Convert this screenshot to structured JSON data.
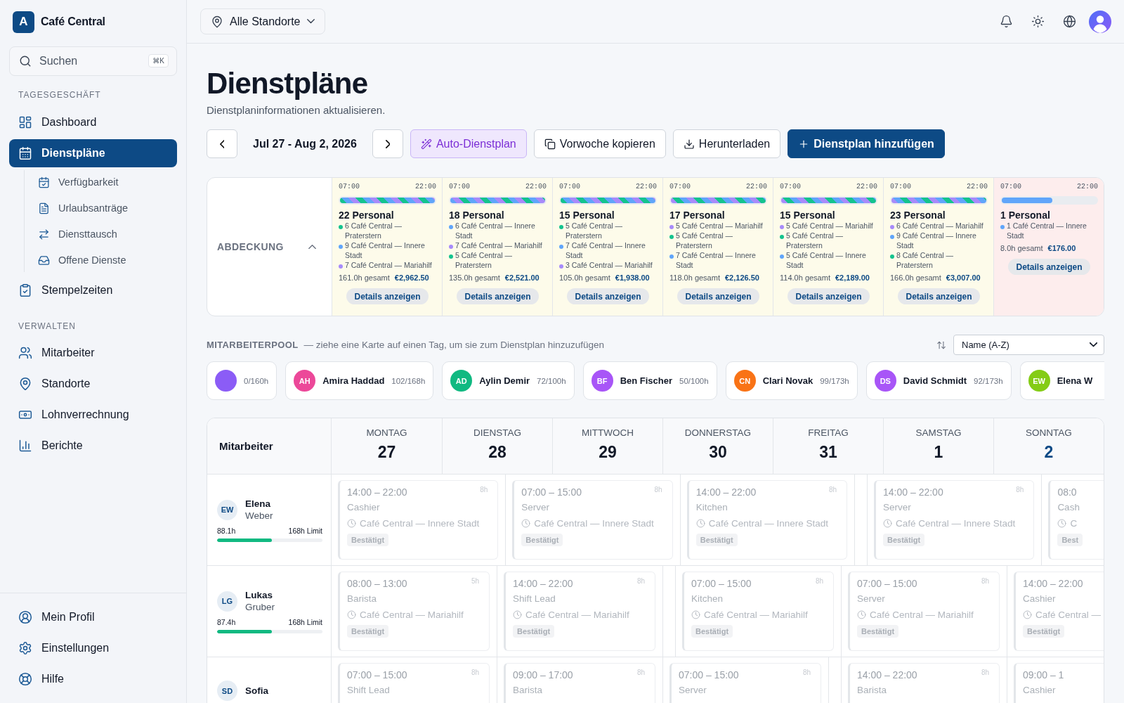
{
  "app": {
    "logo": "A",
    "name": "Café Central"
  },
  "search": {
    "placeholder": "Suchen",
    "shortcut": "⌘K"
  },
  "sidebar": {
    "sections": [
      {
        "title": "TAGESGESCHÄFT",
        "items": [
          {
            "label": "Dashboard",
            "selected": false
          },
          {
            "label": "Dienstpläne",
            "selected": true,
            "children": [
              {
                "label": "Verfügbarkeit",
                "selected": false
              },
              {
                "label": "Urlaubsanträge",
                "selected": false
              },
              {
                "label": "Diensttausch",
                "selected": false
              },
              {
                "label": "Offene Dienste",
                "selected": false
              }
            ]
          },
          {
            "label": "Stempelzeiten",
            "selected": false
          }
        ]
      },
      {
        "title": "VERWALTEN",
        "items": [
          {
            "label": "Mitarbeiter",
            "selected": false
          },
          {
            "label": "Standorte",
            "selected": false
          },
          {
            "label": "Lohnverrechnung",
            "selected": false
          },
          {
            "label": "Berichte",
            "selected": false
          }
        ]
      }
    ],
    "footer": [
      {
        "label": "Mein Profil",
        "selected": false
      },
      {
        "label": "Einstellungen",
        "selected": false
      },
      {
        "label": "Hilfe",
        "selected": false
      }
    ]
  },
  "topbar": {
    "location": "Alle Standorte"
  },
  "page": {
    "title": "Dienstpläne",
    "subtitle": "Dienstplaninformationen aktualisieren."
  },
  "toolbar": {
    "range": "Jul 27 - Aug 2, 2026",
    "buttons": [
      {
        "label": "Auto-Dienstplan",
        "kind": "magic"
      },
      {
        "label": "Vorwoche kopieren",
        "kind": "copy"
      },
      {
        "label": "Herunterladen",
        "kind": "download"
      },
      {
        "label": "Dienstplan hinzufügen",
        "kind": "add"
      }
    ]
  },
  "coverage": {
    "label": "ABDECKUNG",
    "expanded": true,
    "days": [
      {
        "start": "07:00",
        "end": "22:00",
        "level": 1,
        "staff": "22 Personal",
        "locations": [
          {
            "text": "6 Café Central — Praterstern",
            "color": "#14c38e"
          },
          {
            "text": "9 Café Central — Innere Stadt",
            "color": "#60a5fa"
          },
          {
            "text": "7 Café Central — Mariahilf",
            "color": "#a78bfa"
          }
        ],
        "hours": "161.0h gesamt",
        "cost": "€2,962.50",
        "button": "Details anzeigen",
        "understaffed": false
      },
      {
        "start": "07:00",
        "end": "22:00",
        "level": 1,
        "staff": "18 Personal",
        "locations": [
          {
            "text": "6 Café Central — Innere Stadt",
            "color": "#60a5fa"
          },
          {
            "text": "7 Café Central — Mariahilf",
            "color": "#a78bfa"
          },
          {
            "text": "5 Café Central — Praterstern",
            "color": "#14c38e"
          }
        ],
        "hours": "135.0h gesamt",
        "cost": "€2,521.00",
        "button": "Details anzeigen",
        "understaffed": false
      },
      {
        "start": "07:00",
        "end": "22:00",
        "level": 1,
        "staff": "15 Personal",
        "locations": [
          {
            "text": "5 Café Central — Praterstern",
            "color": "#14c38e"
          },
          {
            "text": "7 Café Central — Innere Stadt",
            "color": "#60a5fa"
          },
          {
            "text": "3 Café Central — Mariahilf",
            "color": "#a78bfa"
          }
        ],
        "hours": "105.0h gesamt",
        "cost": "€1,938.00",
        "button": "Details anzeigen",
        "understaffed": false
      },
      {
        "start": "07:00",
        "end": "22:00",
        "level": 1,
        "staff": "17 Personal",
        "locations": [
          {
            "text": "5 Café Central — Mariahilf",
            "color": "#a78bfa"
          },
          {
            "text": "5 Café Central — Praterstern",
            "color": "#14c38e"
          },
          {
            "text": "7 Café Central — Innere Stadt",
            "color": "#60a5fa"
          }
        ],
        "hours": "118.0h gesamt",
        "cost": "€2,126.50",
        "button": "Details anzeigen",
        "understaffed": false
      },
      {
        "start": "07:00",
        "end": "22:00",
        "level": 1,
        "staff": "15 Personal",
        "locations": [
          {
            "text": "5 Café Central — Mariahilf",
            "color": "#a78bfa"
          },
          {
            "text": "5 Café Central — Praterstern",
            "color": "#14c38e"
          },
          {
            "text": "5 Café Central — Innere Stadt",
            "color": "#60a5fa"
          }
        ],
        "hours": "114.0h gesamt",
        "cost": "€2,189.00",
        "button": "Details anzeigen",
        "understaffed": false
      },
      {
        "start": "07:00",
        "end": "22:00",
        "level": 1,
        "staff": "23 Personal",
        "locations": [
          {
            "text": "6 Café Central — Mariahilf",
            "color": "#a78bfa"
          },
          {
            "text": "9 Café Central — Innere Stadt",
            "color": "#60a5fa"
          },
          {
            "text": "8 Café Central — Praterstern",
            "color": "#14c38e"
          }
        ],
        "hours": "166.0h gesamt",
        "cost": "€3,007.00",
        "button": "Details anzeigen",
        "understaffed": false
      },
      {
        "start": "07:00",
        "end": "22:00",
        "level": 0.53,
        "staff": "1 Personal",
        "locations": [
          {
            "text": "1 Café Central — Innere Stadt",
            "color": "#60a5fa"
          }
        ],
        "hours": "8.0h gesamt",
        "cost": "€176.00",
        "button": "Details anzeigen",
        "understaffed": true
      }
    ]
  },
  "pool": {
    "title": "MITARBEITERPOOL",
    "hint": "— ziehe eine Karte auf einen Tag, um sie zum Dienstplan hinzuzufügen",
    "sort": "Name (A-Z)",
    "employees": [
      {
        "color": "#8b5cf6",
        "hours": "0/160h"
      },
      {
        "initials": "AH",
        "name": "Amira Haddad",
        "hours": "102/168h",
        "color": "#ec4899"
      },
      {
        "initials": "AD",
        "name": "Aylin Demir",
        "hours": "72/100h",
        "color": "#10b981"
      },
      {
        "initials": "BF",
        "name": "Ben Fischer",
        "hours": "50/100h",
        "color": "#a855f7"
      },
      {
        "initials": "CN",
        "name": "Clari Novak",
        "hours": "99/173h",
        "color": "#f97316"
      },
      {
        "initials": "DS",
        "name": "David Schmidt",
        "hours": "92/173h",
        "color": "#a855f7"
      },
      {
        "initials": "EW",
        "name": "Elena W",
        "color": "#84cc16"
      }
    ]
  },
  "grid": {
    "header": "Mitarbeiter",
    "days": [
      {
        "name": "MONTAG",
        "date": "27",
        "today": false
      },
      {
        "name": "DIENSTAG",
        "date": "28",
        "today": false
      },
      {
        "name": "MITTWOCH",
        "date": "29",
        "today": false
      },
      {
        "name": "DONNERSTAG",
        "date": "30",
        "today": false
      },
      {
        "name": "FREITAG",
        "date": "31",
        "today": false
      },
      {
        "name": "SAMSTAG",
        "date": "1",
        "today": false
      },
      {
        "name": "SONNTAG",
        "date": "2",
        "today": true
      }
    ],
    "rows": [
      {
        "initials": "EW",
        "first_name": "Elena",
        "last_name": "Weber",
        "hours": "88.1h",
        "limit": "168h Limit",
        "level": 0.52,
        "cells": [
          {
            "kind": "shift",
            "time": "14:00 – 22:00",
            "duration": "8h",
            "role": "Cashier",
            "location": "Café Central — Innere Stadt",
            "status": "Bestätigt"
          },
          {
            "kind": "shift",
            "time": "07:00 – 15:00",
            "duration": "8h",
            "role": "Server",
            "location": "Café Central — Innere Stadt",
            "status": "Bestätigt"
          },
          {
            "kind": "shift",
            "time": "14:00 – 22:00",
            "duration": "8h",
            "role": "Kitchen",
            "location": "Café Central — Innere Stadt",
            "status": "Bestätigt"
          },
          {
            "kind": "empty"
          },
          {
            "kind": "shift",
            "time": "14:00 – 22:00",
            "duration": "8h",
            "role": "Server",
            "location": "Café Central — Innere Stadt",
            "status": "Bestätigt"
          },
          {
            "kind": "shift",
            "time": "08:0",
            "role": "Cash",
            "location": "C",
            "status": "Best"
          }
        ]
      },
      {
        "initials": "LG",
        "first_name": "Lukas",
        "last_name": "Gruber",
        "hours": "87.4h",
        "limit": "168h Limit",
        "level": 0.52,
        "cells": [
          {
            "kind": "shift",
            "time": "08:00 – 13:00",
            "duration": "5h",
            "role": "Barista",
            "location": "Café Central — Mariahilf",
            "status": "Bestätigt"
          },
          {
            "kind": "shift",
            "time": "14:00 – 22:00",
            "duration": "8h",
            "role": "Shift Lead",
            "location": "Café Central — Mariahilf",
            "status": "Bestätigt"
          },
          {
            "kind": "empty"
          },
          {
            "kind": "shift",
            "time": "07:00 – 15:00",
            "duration": "8h",
            "role": "Kitchen",
            "location": "Café Central — Mariahilf",
            "status": "Bestätigt"
          },
          {
            "kind": "shift",
            "time": "07:00 – 15:00",
            "duration": "8h",
            "role": "Server",
            "location": "Café Central — Mariahilf",
            "status": "Bestätigt"
          },
          {
            "kind": "shift",
            "time": "14:00 – 22:00",
            "role": "Cashier",
            "location": "Café Central —",
            "status": "Bestätigt"
          }
        ]
      },
      {
        "initials": "SD",
        "first_name": "Sofia",
        "cells": [
          {
            "kind": "shift",
            "time": "07:00 – 15:00",
            "duration": "8h",
            "role": "Shift Lead"
          },
          {
            "kind": "shift",
            "time": "09:00 – 17:00",
            "duration": "8h",
            "role": "Barista"
          },
          {
            "kind": "shift",
            "time": "07:00 – 15:00",
            "duration": "8h",
            "role": "Server"
          },
          {
            "kind": "empty"
          },
          {
            "kind": "shift",
            "time": "14:00 – 22:00",
            "duration": "8h",
            "role": "Barista"
          },
          {
            "kind": "shift",
            "time": "09:00 – 1",
            "role": "Cashier"
          }
        ]
      }
    ]
  }
}
